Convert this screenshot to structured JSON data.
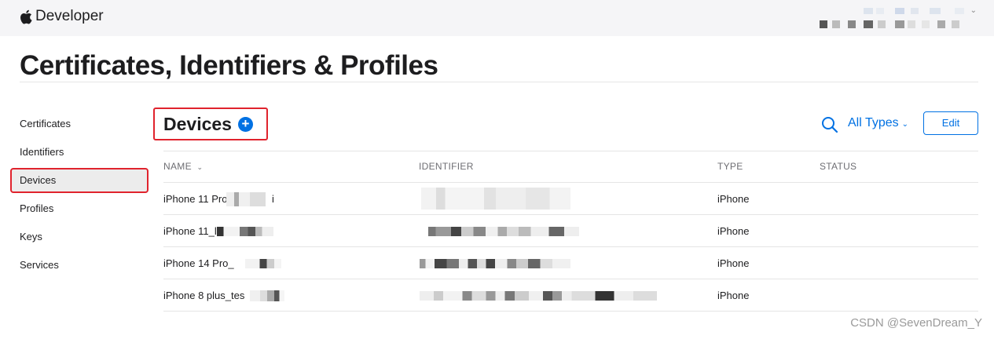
{
  "brand": {
    "name": "Developer"
  },
  "page_title": "Certificates, Identifiers & Profiles",
  "sidebar": {
    "items": [
      {
        "label": "Certificates"
      },
      {
        "label": "Identifiers"
      },
      {
        "label": "Devices",
        "active": true
      },
      {
        "label": "Profiles"
      },
      {
        "label": "Keys"
      },
      {
        "label": "Services"
      }
    ]
  },
  "section": {
    "title": "Devices",
    "add_label": "+"
  },
  "toolbar": {
    "filter_label": "All Types",
    "edit_label": "Edit"
  },
  "table": {
    "headers": {
      "name": "NAME",
      "identifier": "IDENTIFIER",
      "type": "TYPE",
      "status": "STATUS"
    },
    "rows": [
      {
        "name": "iPhone 11 Pro",
        "name_tail": "i",
        "identifier": "",
        "type": "iPhone",
        "status": ""
      },
      {
        "name": "iPhone 11_l",
        "name_tail": "",
        "identifier": "",
        "type": "iPhone",
        "status": ""
      },
      {
        "name": "iPhone 14 Pro_",
        "name_tail": "",
        "identifier": "",
        "type": "iPhone",
        "status": ""
      },
      {
        "name": "iPhone 8 plus_tes",
        "name_tail": "",
        "identifier": "",
        "type": "iPhone",
        "status": ""
      }
    ]
  },
  "watermark": "CSDN @SevenDream_Y",
  "colors": {
    "accent": "#0071e3",
    "highlight_box": "#e0232d",
    "topbar_bg": "#f5f5f7"
  }
}
